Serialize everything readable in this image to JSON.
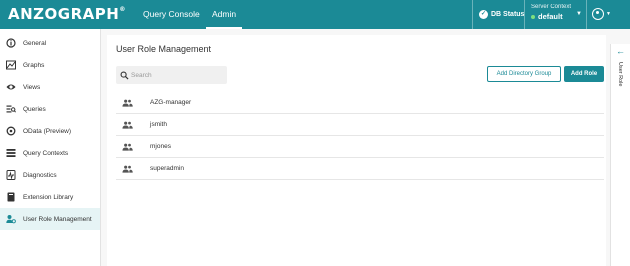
{
  "header": {
    "logo": "ANZOGRAPH",
    "logo_mark": "®",
    "tabs": [
      {
        "label": "Query Console",
        "active": false
      },
      {
        "label": "Admin",
        "active": true
      }
    ],
    "db_status": "DB Status",
    "server_context_label": "Server Context",
    "server_context_value": "default",
    "accent_color": "#1b8a96"
  },
  "sidebar": {
    "items": [
      {
        "label": "General",
        "icon": "info-icon"
      },
      {
        "label": "Graphs",
        "icon": "graph-icon"
      },
      {
        "label": "Views",
        "icon": "eye-icon"
      },
      {
        "label": "Queries",
        "icon": "queries-icon"
      },
      {
        "label": "OData (Preview)",
        "icon": "odata-icon"
      },
      {
        "label": "Query Contexts",
        "icon": "list-icon"
      },
      {
        "label": "Diagnostics",
        "icon": "diagnostics-icon"
      },
      {
        "label": "Extension Library",
        "icon": "book-icon"
      },
      {
        "label": "User Role Management",
        "icon": "user-roles-icon",
        "active": true
      }
    ]
  },
  "main": {
    "title": "User Role Management",
    "search_placeholder": "Search",
    "add_directory_group": "Add Directory Group",
    "add_role": "Add Role",
    "roles": [
      {
        "name": "AZG-manager"
      },
      {
        "name": "jsmith"
      },
      {
        "name": "mjones"
      },
      {
        "name": "superadmin"
      }
    ]
  },
  "rail": {
    "label": "User Role"
  }
}
